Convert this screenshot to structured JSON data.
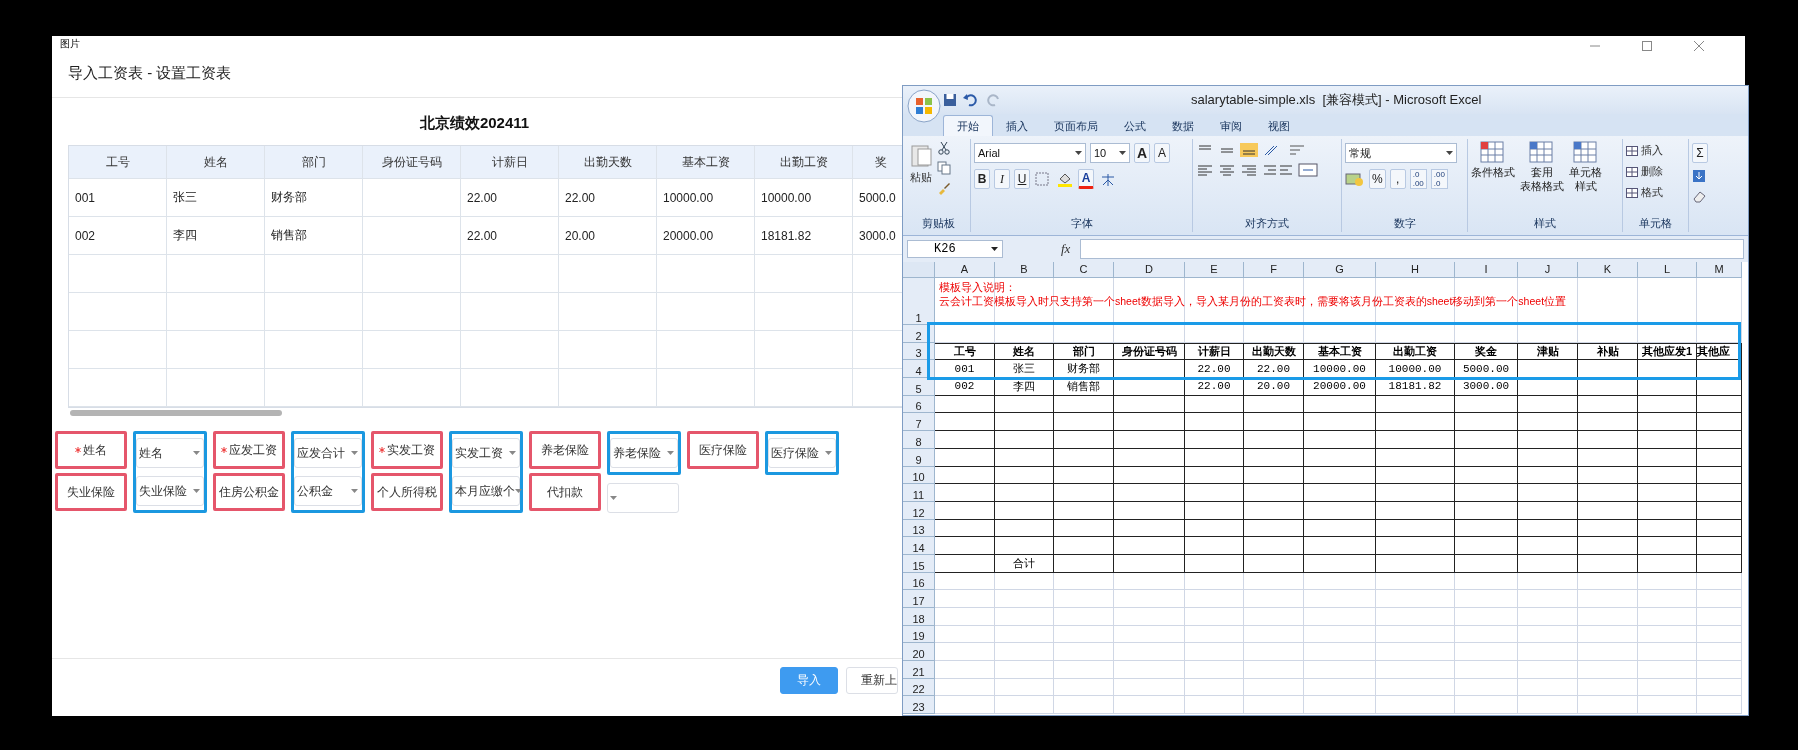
{
  "dialog": {
    "caption": "图片",
    "title": "导入工资表 - 设置工资表",
    "sheet_name": "北京绩效202411"
  },
  "table": {
    "columns": [
      "工号",
      "姓名",
      "部门",
      "身份证号码",
      "计薪日",
      "出勤天数",
      "基本工资",
      "出勤工资",
      "奖"
    ],
    "rows": [
      {
        "cells": [
          "001",
          "张三",
          "财务部",
          null,
          "22.00",
          "22.00",
          "10000.00",
          "10000.00",
          "5000.0"
        ]
      },
      {
        "cells": [
          "002",
          "李四",
          "销售部",
          null,
          "22.00",
          "20.00",
          "20000.00",
          "18181.82",
          "3000.0"
        ]
      }
    ]
  },
  "mapping_columns": [
    {
      "pairs": [
        {
          "label": "姓名",
          "required": true,
          "marked": true,
          "value": "姓名",
          "select_framed": true
        },
        {
          "label": "失业保险",
          "required": false,
          "marked": true,
          "value": "失业保险",
          "select_framed": true
        }
      ]
    },
    {
      "pairs": [
        {
          "label": "应发工资",
          "required": true,
          "marked": true,
          "value": "应发合计",
          "select_framed": true
        },
        {
          "label": "住房公积金",
          "required": false,
          "marked": true,
          "value": "公积金",
          "select_framed": true
        }
      ]
    },
    {
      "pairs": [
        {
          "label": "实发工资",
          "required": true,
          "marked": true,
          "value": "实发工资",
          "select_framed": true
        },
        {
          "label": "个人所得税",
          "required": false,
          "marked": true,
          "value": "本月应缴个",
          "select_framed": true
        }
      ]
    },
    {
      "pairs": [
        {
          "label": "养老保险",
          "required": false,
          "marked": true,
          "value": "养老保险",
          "select_framed": true
        },
        {
          "label": "代扣款",
          "required": false,
          "marked": true,
          "select_framed": false
        }
      ]
    },
    {
      "pairs": [
        {
          "label": "医疗保险",
          "required": false,
          "marked": true,
          "value": "医疗保险",
          "select_framed": true
        }
      ]
    }
  ],
  "buttons": [
    {
      "label": "导入",
      "kind": "primary"
    },
    {
      "label": "重新上",
      "kind": "default"
    }
  ],
  "excel": {
    "title": "salarytable-simple.xls  [兼容模式] - Microsoft Excel",
    "tabs": [
      {
        "label": "开始",
        "selected": true
      },
      {
        "label": "插入",
        "selected": false
      },
      {
        "label": "页面布局",
        "selected": false
      },
      {
        "label": "公式",
        "selected": false
      },
      {
        "label": "数据",
        "selected": false
      },
      {
        "label": "审阅",
        "selected": false
      },
      {
        "label": "视图",
        "selected": false
      }
    ],
    "ribbon": {
      "clipboard": {
        "label": "剪贴板",
        "paste": "粘贴"
      },
      "font": {
        "label": "字体",
        "font_name": "Arial",
        "font_size": "10",
        "grow": "A",
        "shrink": "A",
        "styles": [
          "B",
          "I",
          "U"
        ],
        "font_color_letter": "A"
      },
      "alignment": {
        "label": "对齐方式"
      },
      "number": {
        "label": "数字",
        "format": "常规",
        "symbols": [
          "%",
          ","
        ],
        "decimals": [
          {
            "top": ".0",
            "bottom": ".00"
          },
          {
            "top": ".00",
            "bottom": ".0"
          }
        ]
      },
      "styles": {
        "label": "样式",
        "buttons": [
          [
            "条件格式"
          ],
          [
            "套用",
            "表格格式"
          ],
          [
            "单元格",
            "样式"
          ]
        ]
      },
      "cells": {
        "label": "单元格",
        "buttons": [
          "插入",
          "删除",
          "格式"
        ]
      },
      "editing": {
        "sum": "Σ"
      }
    },
    "name_box": "K26",
    "fx": "fx",
    "columns": [
      "A",
      "B",
      "C",
      "D",
      "E",
      "F",
      "G",
      "H",
      "I",
      "J",
      "K",
      "L",
      "M"
    ],
    "note": [
      "模板导入说明：",
      "云会计工资模板导入时只支持第一个sheet数据导入，导入某月份的工资表时，需要将该月份工资表的sheet移动到第一个sheet位置"
    ],
    "rows": [
      {
        "number": "1",
        "bordered": false
      },
      {
        "number": "2",
        "bordered": false
      },
      {
        "number": "3",
        "bordered": true,
        "kind": "header",
        "cells": [
          "工号",
          "姓名",
          "部门",
          "身份证号码",
          "计薪日",
          "出勤天数",
          "基本工资",
          "出勤工资",
          "奖金",
          "津贴",
          "补贴",
          "其他应发1",
          "其他应"
        ]
      },
      {
        "number": "4",
        "bordered": true,
        "cells": [
          "001",
          "张三",
          "财务部",
          null,
          "22.00",
          "22.00",
          "10000.00",
          "10000.00",
          "5000.00"
        ]
      },
      {
        "number": "5",
        "bordered": true,
        "cells": [
          "002",
          "李四",
          "销售部",
          null,
          "22.00",
          "20.00",
          "20000.00",
          "18181.82",
          "3000.00"
        ]
      },
      {
        "number": "6",
        "bordered": true
      },
      {
        "number": "7",
        "bordered": true
      },
      {
        "number": "8",
        "bordered": true
      },
      {
        "number": "9",
        "bordered": true
      },
      {
        "number": "10",
        "bordered": true
      },
      {
        "number": "11",
        "bordered": true
      },
      {
        "number": "12",
        "bordered": true
      },
      {
        "number": "13",
        "bordered": true
      },
      {
        "number": "14",
        "bordered": true
      },
      {
        "number": "15",
        "bordered": true,
        "cells": [
          null,
          "合计"
        ]
      },
      {
        "number": "16",
        "bordered": false
      },
      {
        "number": "17",
        "bordered": false
      },
      {
        "number": "18",
        "bordered": false
      },
      {
        "number": "19",
        "bordered": false
      },
      {
        "number": "20",
        "bordered": false
      },
      {
        "number": "21",
        "bordered": false
      },
      {
        "number": "22",
        "bordered": false
      },
      {
        "number": "23",
        "bordered": false
      }
    ]
  }
}
